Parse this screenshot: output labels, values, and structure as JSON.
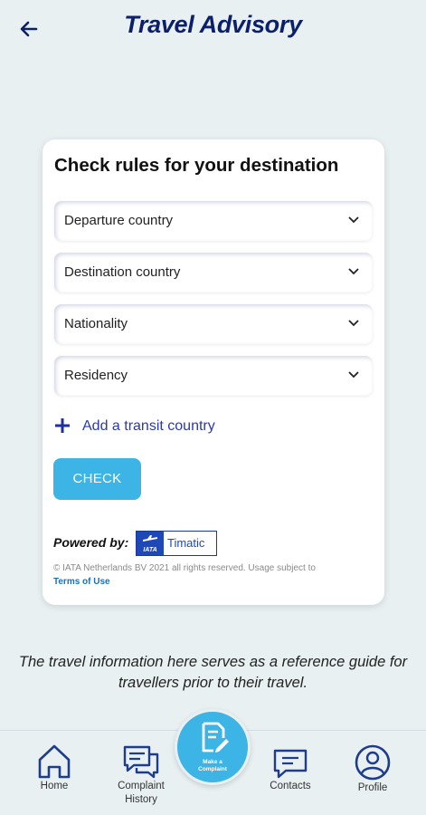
{
  "header": {
    "title": "Travel Advisory"
  },
  "card": {
    "title": "Check rules for your destination",
    "selects": [
      {
        "label": "Departure country"
      },
      {
        "label": "Destination country"
      },
      {
        "label": "Nationality"
      },
      {
        "label": "Residency"
      }
    ],
    "transit_label": "Add a transit country",
    "check_label": "CHECK",
    "powered_by": "Powered by:",
    "logo": {
      "iata": "IATA",
      "timatic": "Timatic"
    },
    "copyright": "© IATA Netherlands BV 2021 all rights reserved. Usage subject to",
    "terms_link": "Terms of Use"
  },
  "info_text": "The travel information here serves as a reference guide for travellers prior to their travel.",
  "nav": {
    "home": "Home",
    "complaint_history": "Complaint History",
    "make_complaint": "Make a Complaint",
    "contacts": "Contacts",
    "profile": "Profile"
  },
  "colors": {
    "background": "#e8f0f2",
    "title": "#0b1f6b",
    "accent": "#3cb4e6",
    "link": "#2a3aa8",
    "nav_icon": "#1e3c8c"
  }
}
